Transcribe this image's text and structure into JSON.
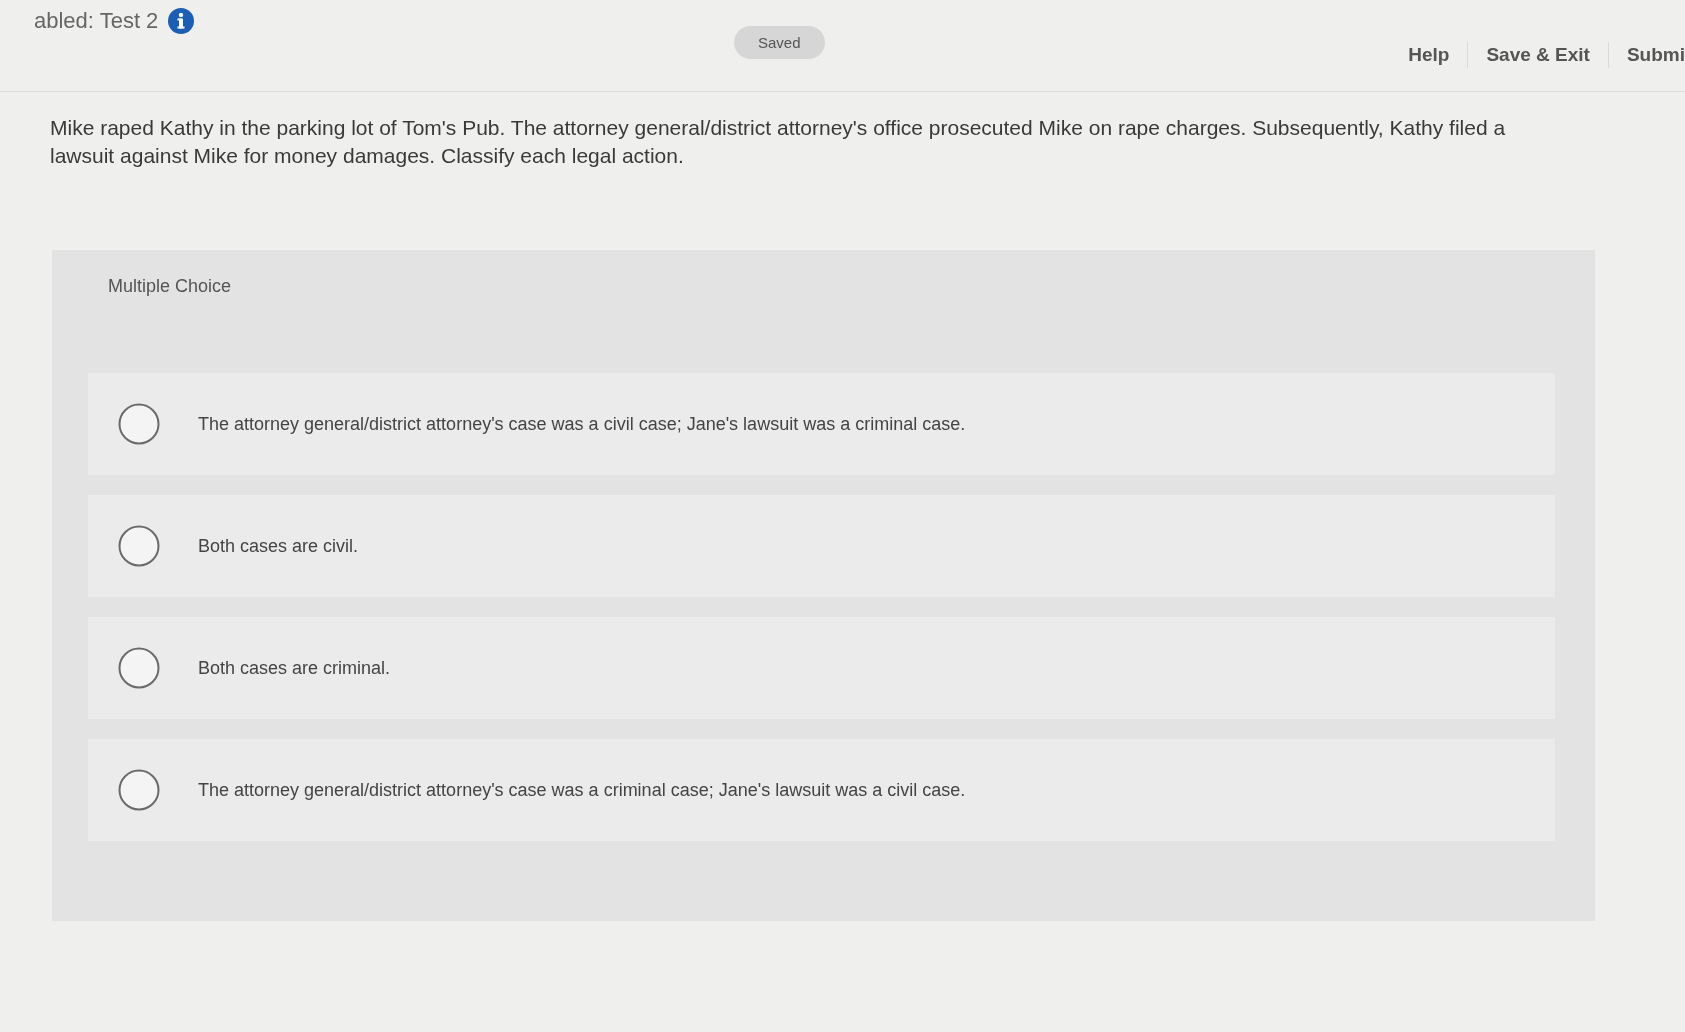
{
  "header": {
    "title": "abled: Test 2",
    "status": "Saved",
    "links": [
      "Help",
      "Save & Exit",
      "Submi"
    ]
  },
  "question": {
    "text": "Mike raped Kathy in the parking lot of Tom's Pub. The attorney general/district attorney's office prosecuted Mike on rape charges. Subsequently, Kathy filed a lawsuit against Mike for money damages. Classify each legal action."
  },
  "answer_panel": {
    "label": "Multiple Choice",
    "options": [
      {
        "text": "The attorney general/district attorney's case was a civil case; Jane's lawsuit was a criminal case.",
        "selected": false
      },
      {
        "text": "Both cases are civil.",
        "selected": false
      },
      {
        "text": "Both cases are criminal.",
        "selected": false
      },
      {
        "text": "The attorney general/district attorney's case was a criminal case; Jane's lawsuit was a civil case.",
        "selected": false
      }
    ]
  }
}
